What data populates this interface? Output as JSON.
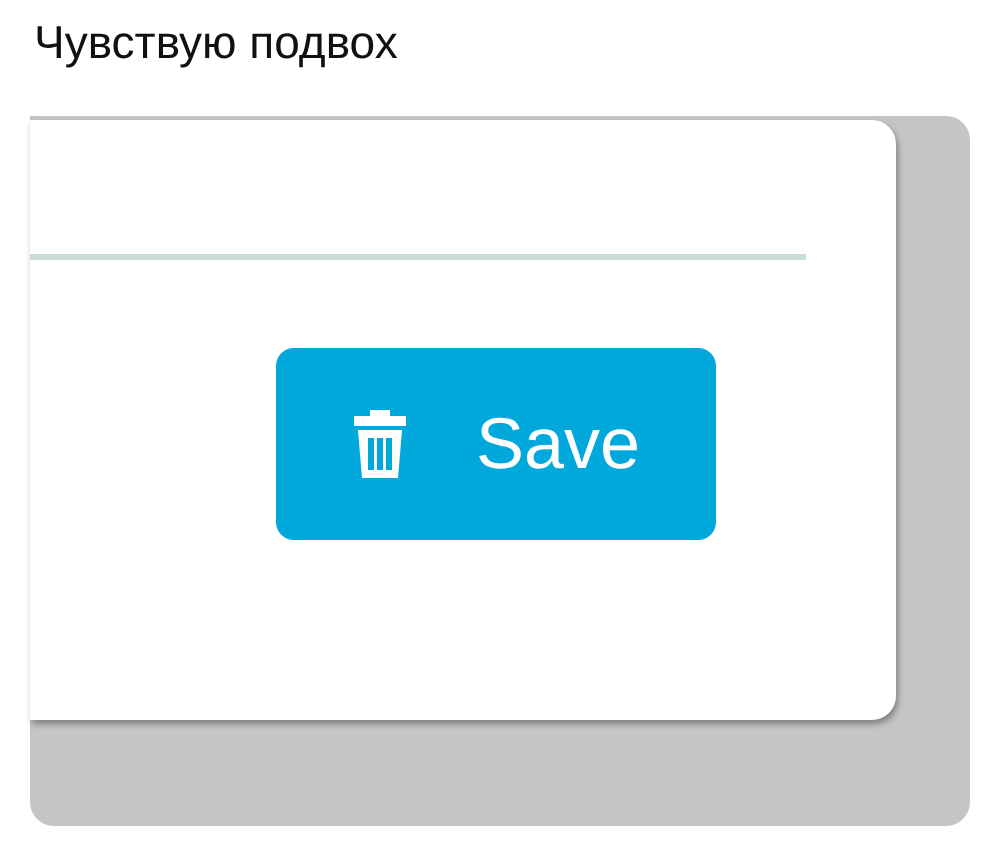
{
  "post": {
    "caption": "Чувствую подвох"
  },
  "dialog": {
    "button": {
      "label": "Save"
    }
  }
}
